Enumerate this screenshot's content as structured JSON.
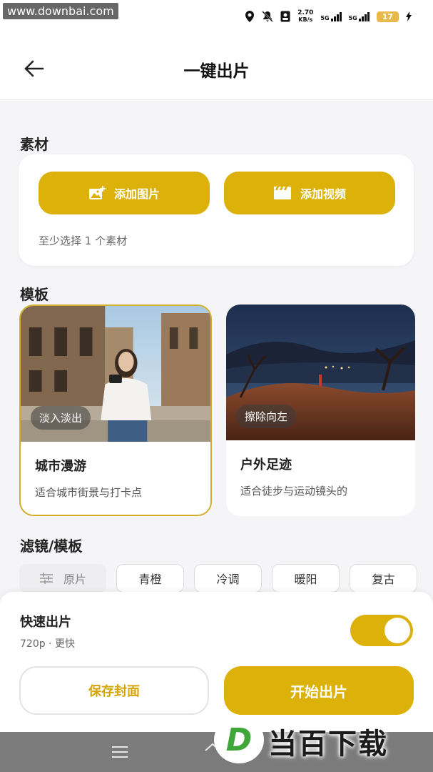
{
  "status_bar": {
    "watermark": "www.downbai.com",
    "speed_value": "2.70",
    "speed_unit": "KB/s",
    "net1": "5G",
    "net2": "5G",
    "battery": "17"
  },
  "header": {
    "title": "一键出片",
    "back_icon": "arrow-left-icon"
  },
  "material": {
    "label": "素材",
    "add_image": "添加图片",
    "add_video": "添加视频",
    "hint": "至少选择 1 个素材"
  },
  "templates": {
    "label": "模板",
    "items": [
      {
        "tag": "淡入淡出",
        "name": "城市漫游",
        "desc": "适合城市街景与打卡点",
        "selected": true
      },
      {
        "tag": "擦除向左",
        "name": "户外足迹",
        "desc": "适合徒步与运动镜头的"
      }
    ]
  },
  "filters": {
    "label": "滤镜/模板",
    "items": [
      "原片",
      "青橙",
      "冷调",
      "暖阳",
      "复古"
    ],
    "selected": "原片"
  },
  "quick_output": {
    "title": "快速出片",
    "sub": "720p · 更快",
    "enabled": true
  },
  "actions": {
    "save_cover": "保存封面",
    "start": "开始出片"
  },
  "brand_watermark": {
    "letter": "D",
    "text": "当百下载"
  },
  "colors": {
    "accent": "#dbb10a",
    "background": "#f5f5f7"
  }
}
